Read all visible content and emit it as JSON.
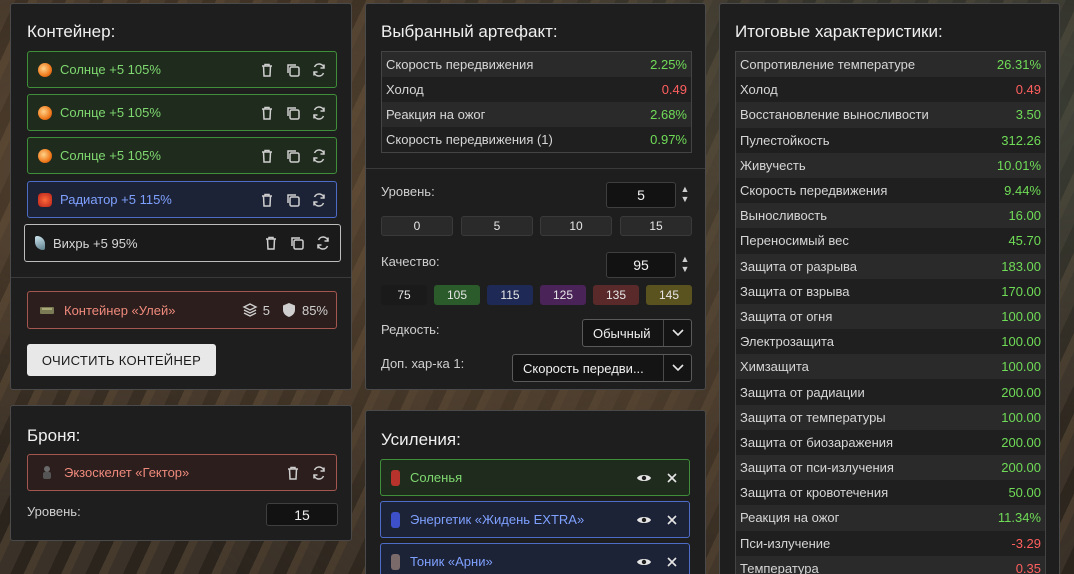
{
  "container": {
    "title": "Контейнер:",
    "slots": [
      {
        "name": "Солнце +5 105%",
        "color": "green",
        "icon": "sun-artifact-icon"
      },
      {
        "name": "Солнце +5 105%",
        "color": "green",
        "icon": "sun-artifact-icon"
      },
      {
        "name": "Солнце +5 105%",
        "color": "green",
        "icon": "sun-artifact-icon"
      },
      {
        "name": "Радиатор +5 115%",
        "color": "blue",
        "icon": "radiator-artifact-icon"
      },
      {
        "name": "Вихрь +5 95%",
        "color": "gray",
        "icon": "vortex-artifact-icon"
      }
    ],
    "box": {
      "name": "Контейнер «Улей»",
      "slots_count": "5",
      "protection": "85%"
    },
    "clear_button": "ОЧИСТИТЬ КОНТЕЙНЕР"
  },
  "armor": {
    "title": "Броня:",
    "item": "Экзоскелет «Гектор»",
    "level_label": "Уровень:",
    "level_value": "15"
  },
  "selected": {
    "title": "Выбранный артефакт:",
    "stats": [
      {
        "name": "Скорость передвижения",
        "value": "2.25%",
        "sign": "pos"
      },
      {
        "name": "Холод",
        "value": "0.49",
        "sign": "neg"
      },
      {
        "name": "Реакция на ожог",
        "value": "2.68%",
        "sign": "pos"
      },
      {
        "name": "Скорость передвижения (1)",
        "value": "0.97%",
        "sign": "pos"
      }
    ],
    "level_label": "Уровень:",
    "level_value": "5",
    "level_presets": [
      "0",
      "5",
      "10",
      "15"
    ],
    "quality_label": "Качество:",
    "quality_value": "95",
    "quality_presets": [
      {
        "label": "75",
        "color": "#1a1a1a"
      },
      {
        "label": "105",
        "color": "#2b5a2b"
      },
      {
        "label": "115",
        "color": "#1e2a55"
      },
      {
        "label": "125",
        "color": "#4a2358"
      },
      {
        "label": "135",
        "color": "#5a2a2a"
      },
      {
        "label": "145",
        "color": "#5a5320"
      }
    ],
    "rarity_label": "Редкость:",
    "rarity_value": "Обычный",
    "extra_label": "Доп. хар-ка 1:",
    "extra_value": "Скорость передви..."
  },
  "boosts": {
    "title": "Усиления:",
    "items": [
      {
        "name": "Соленья",
        "color": "green"
      },
      {
        "name": "Энергетик «Жидень EXTRA»",
        "color": "blue"
      },
      {
        "name": "Тоник «Арни»",
        "color": "blue"
      }
    ]
  },
  "totals": {
    "title": "Итоговые характеристики:",
    "rows": [
      {
        "name": "Сопротивление температуре",
        "value": "26.31%",
        "sign": "pos"
      },
      {
        "name": "Холод",
        "value": "0.49",
        "sign": "neg"
      },
      {
        "name": "Восстановление выносливости",
        "value": "3.50",
        "sign": "pos"
      },
      {
        "name": "Пулестойкость",
        "value": "312.26",
        "sign": "pos"
      },
      {
        "name": "Живучесть",
        "value": "10.01%",
        "sign": "pos"
      },
      {
        "name": "Скорость передвижения",
        "value": "9.44%",
        "sign": "pos"
      },
      {
        "name": "Выносливость",
        "value": "16.00",
        "sign": "pos"
      },
      {
        "name": "Переносимый вес",
        "value": "45.70",
        "sign": "pos"
      },
      {
        "name": "Защита от разрыва",
        "value": "183.00",
        "sign": "pos"
      },
      {
        "name": "Защита от взрыва",
        "value": "170.00",
        "sign": "pos"
      },
      {
        "name": "Защита от огня",
        "value": "100.00",
        "sign": "pos"
      },
      {
        "name": "Электрозащита",
        "value": "100.00",
        "sign": "pos"
      },
      {
        "name": "Химзащита",
        "value": "100.00",
        "sign": "pos"
      },
      {
        "name": "Защита от радиации",
        "value": "200.00",
        "sign": "pos"
      },
      {
        "name": "Защита от температуры",
        "value": "100.00",
        "sign": "pos"
      },
      {
        "name": "Защита от биозаражения",
        "value": "200.00",
        "sign": "pos"
      },
      {
        "name": "Защита от пси-излучения",
        "value": "200.00",
        "sign": "pos"
      },
      {
        "name": "Защита от кровотечения",
        "value": "50.00",
        "sign": "pos"
      },
      {
        "name": "Реакция на ожог",
        "value": "11.34%",
        "sign": "pos"
      },
      {
        "name": "Пси-излучение",
        "value": "-3.29",
        "sign": "neg"
      },
      {
        "name": "Температура",
        "value": "0.35",
        "sign": "neg"
      }
    ]
  }
}
